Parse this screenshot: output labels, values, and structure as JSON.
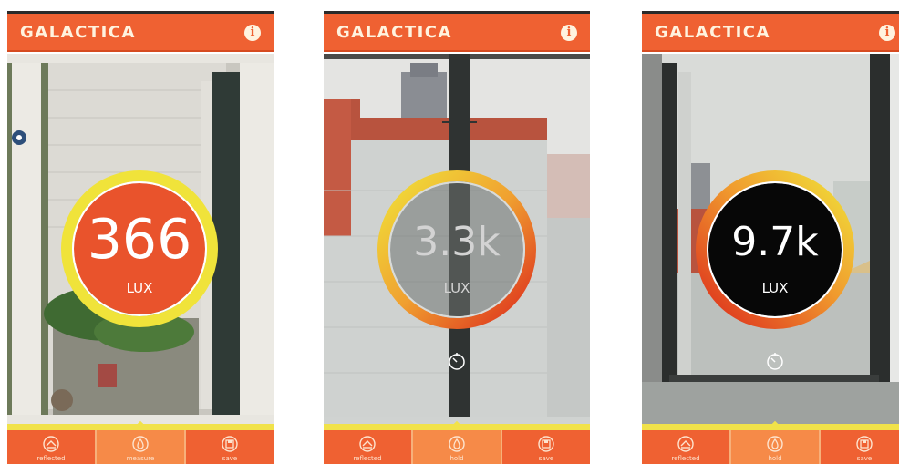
{
  "app": {
    "title": "GALACTICA",
    "info_glyph": "i"
  },
  "colors": {
    "brand": "#ef6132",
    "brand_dark": "#d64b20",
    "highlight": "#f1e24a",
    "ring_yellow": "#f0e33a",
    "ring_red": "#dc2a1c"
  },
  "screens": [
    {
      "reading": {
        "value": "366",
        "unit": "LUX",
        "fill": "orange"
      },
      "show_timer": false,
      "tabs": [
        {
          "label": "reflected",
          "icon": "reflected-light-icon",
          "active": false
        },
        {
          "label": "measure",
          "icon": "light-drop-icon",
          "active": true
        },
        {
          "label": "save",
          "icon": "save-icon",
          "active": false
        }
      ]
    },
    {
      "reading": {
        "value": "3.3k",
        "unit": "LUX",
        "fill": "grey"
      },
      "show_timer": true,
      "tabs": [
        {
          "label": "reflected",
          "icon": "reflected-light-icon",
          "active": false
        },
        {
          "label": "hold",
          "icon": "light-drop-icon",
          "active": true
        },
        {
          "label": "save",
          "icon": "save-icon",
          "active": false
        }
      ]
    },
    {
      "reading": {
        "value": "9.7k",
        "unit": "LUX",
        "fill": "black"
      },
      "show_timer": true,
      "tabs": [
        {
          "label": "reflected",
          "icon": "reflected-light-icon",
          "active": false
        },
        {
          "label": "hold",
          "icon": "light-drop-icon",
          "active": true
        },
        {
          "label": "save",
          "icon": "save-icon",
          "active": false
        }
      ]
    }
  ]
}
